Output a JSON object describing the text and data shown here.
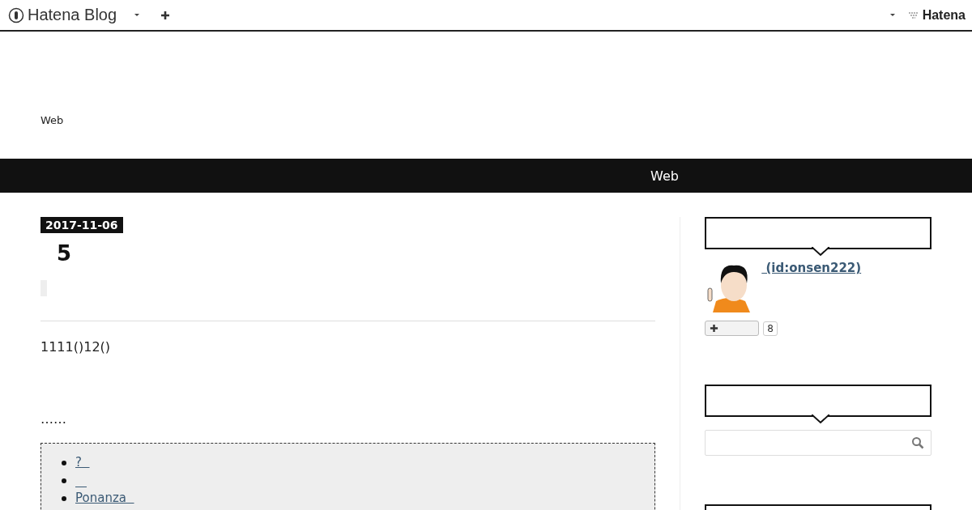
{
  "topbar": {
    "brand": "Hatena Blog",
    "right_brand": "Hatena"
  },
  "header": {
    "description": "Web"
  },
  "navbar": {
    "title": "Web"
  },
  "entry": {
    "date": "2017-11-06",
    "title": "5",
    "intro": "1111()12()",
    "ellipsis": "……",
    "links": [
      {
        "kind": "link",
        "text": "?"
      },
      {
        "kind": "blank"
      },
      {
        "kind": "link",
        "text": "Ponanza"
      }
    ]
  },
  "sidebar": {
    "profile": {
      "name": " (id:onsen222)",
      "star_count": "8"
    },
    "modules": [
      {
        "kind": "profile"
      },
      {
        "kind": "search"
      },
      {
        "kind": "empty"
      }
    ]
  }
}
